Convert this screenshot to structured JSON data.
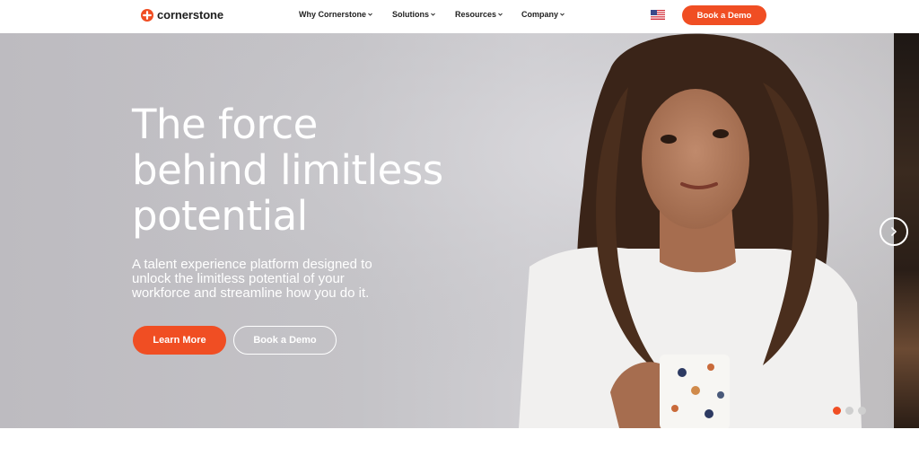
{
  "header": {
    "brand": "cornerstone",
    "nav": [
      {
        "label": "Why Cornerstone"
      },
      {
        "label": "Solutions"
      },
      {
        "label": "Resources"
      },
      {
        "label": "Company"
      }
    ],
    "cta_label": "Book a Demo",
    "locale_icon": "us-flag-icon"
  },
  "hero": {
    "headline_lines": [
      "The force",
      "behind limitless",
      "potential"
    ],
    "subtitle_lines": [
      "A talent experience platform designed to",
      "unlock the limitless potential of your",
      "workforce and streamline how you do it."
    ],
    "primary_cta": "Learn More",
    "secondary_cta": "Book a Demo",
    "next_icon": "chevron-right-icon",
    "slides": {
      "count": 3,
      "active": 1
    }
  },
  "colors": {
    "accent": "#f04e23",
    "hero_text": "#ffffff",
    "nav_text": "#1f1f1f"
  }
}
